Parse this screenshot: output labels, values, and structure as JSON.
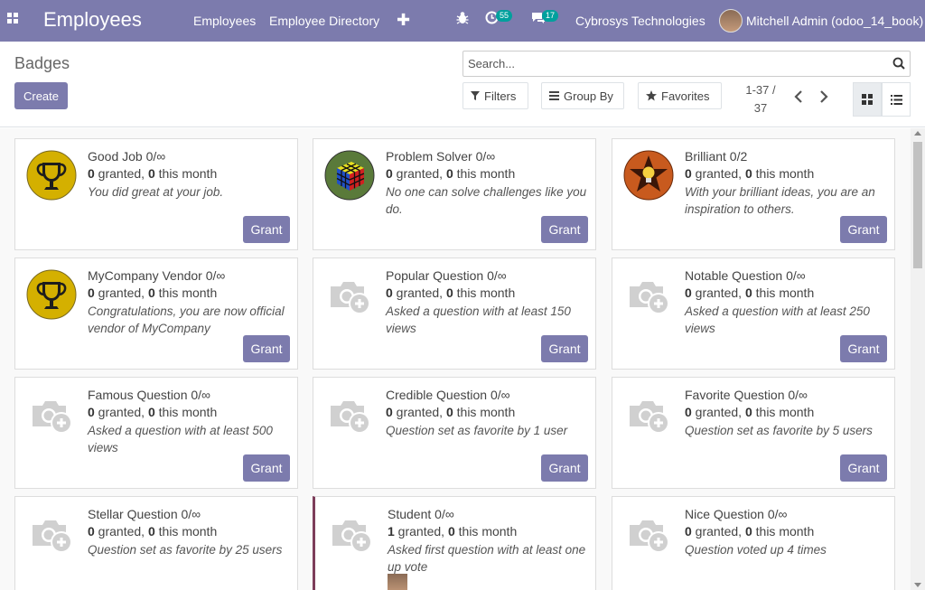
{
  "nav": {
    "app_title": "Employees",
    "menu": [
      "Employees",
      "Employee Directory"
    ],
    "activity_count": "55",
    "message_count": "17",
    "company": "Cybrosys Technologies",
    "user": "Mitchell Admin (odoo_14_book)"
  },
  "control": {
    "title": "Badges",
    "create_label": "Create",
    "search_placeholder": "Search...",
    "filters_label": "Filters",
    "groupby_label": "Group By",
    "favorites_label": "Favorites",
    "pager_line1": "1-37 /",
    "pager_line2": "37"
  },
  "colors": {
    "brand": "#7c7bad",
    "badge_teal": "#00a09d",
    "marked_border": "#7d3d5a"
  },
  "cards": [
    {
      "title": "Good Job 0/∞",
      "granted": "0",
      "month": "0",
      "desc": "You did great at your job.",
      "icon": "trophy-gold",
      "grant": "Grant"
    },
    {
      "title": "Problem Solver 0/∞",
      "granted": "0",
      "month": "0",
      "desc": "No one can solve challenges like you do.",
      "icon": "rubiks-cube",
      "grant": "Grant"
    },
    {
      "title": "Brilliant 0/2",
      "granted": "0",
      "month": "0",
      "desc": "With your brilliant ideas, you are an inspiration to others.",
      "icon": "lightbulb-star",
      "grant": "Grant"
    },
    {
      "title": "MyCompany Vendor 0/∞",
      "granted": "0",
      "month": "0",
      "desc": "Congratulations, you are now official vendor of MyCompany",
      "icon": "trophy-gold",
      "grant": "Grant"
    },
    {
      "title": "Popular Question 0/∞",
      "granted": "0",
      "month": "0",
      "desc": "Asked a question with at least 150 views",
      "icon": "camera-placeholder",
      "grant": "Grant"
    },
    {
      "title": "Notable Question 0/∞",
      "granted": "0",
      "month": "0",
      "desc": "Asked a question with at least 250 views",
      "icon": "camera-placeholder",
      "grant": "Grant"
    },
    {
      "title": "Famous Question 0/∞",
      "granted": "0",
      "month": "0",
      "desc": "Asked a question with at least 500 views",
      "icon": "camera-placeholder",
      "grant": "Grant"
    },
    {
      "title": "Credible Question 0/∞",
      "granted": "0",
      "month": "0",
      "desc": "Question set as favorite by 1 user",
      "icon": "camera-placeholder",
      "grant": "Grant"
    },
    {
      "title": "Favorite Question 0/∞",
      "granted": "0",
      "month": "0",
      "desc": "Question set as favorite by 5 users",
      "icon": "camera-placeholder",
      "grant": "Grant"
    },
    {
      "title": "Stellar Question 0/∞",
      "granted": "0",
      "month": "0",
      "desc": "Question set as favorite by 25 users",
      "icon": "camera-placeholder",
      "grant": ""
    },
    {
      "title": "Student 0/∞",
      "granted": "1",
      "month": "0",
      "desc": "Asked first question with at least one up vote",
      "icon": "camera-placeholder",
      "grant": ""
    },
    {
      "title": "Nice Question 0/∞",
      "granted": "0",
      "month": "0",
      "desc": "Question voted up 4 times",
      "icon": "camera-placeholder",
      "grant": ""
    }
  ],
  "labels": {
    "granted_suffix": " granted, ",
    "month_suffix": " this month"
  }
}
